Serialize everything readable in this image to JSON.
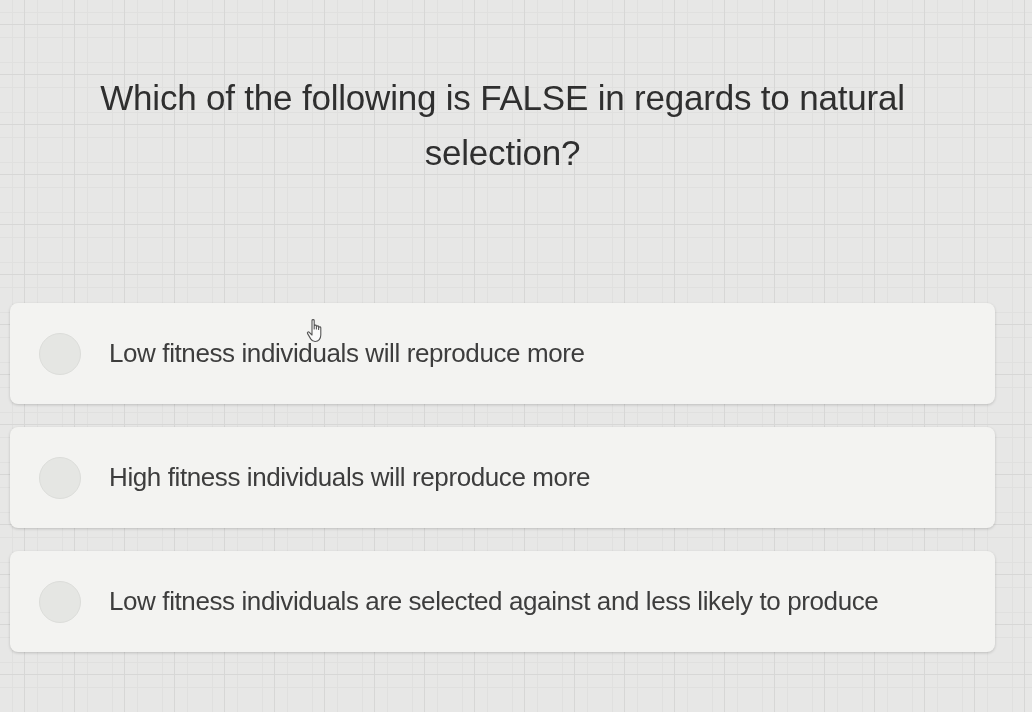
{
  "question": {
    "text": "Which of the following is FALSE in regards to natural selection?"
  },
  "options": [
    {
      "text": "Low fitness individuals will reproduce more",
      "selected": false
    },
    {
      "text": "High fitness individuals will reproduce more",
      "selected": false
    },
    {
      "text": "Low fitness individuals are selected against and less likely to produce",
      "selected": false
    }
  ]
}
